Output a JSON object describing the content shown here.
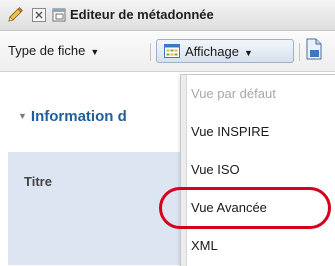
{
  "window": {
    "title": "Editeur de métadonnée"
  },
  "toolbar": {
    "type_label": "Type de fiche",
    "affichage_label": "Affichage",
    "caret": "▼"
  },
  "content": {
    "section_title": "Information d",
    "section_toggle": "▼",
    "field_label": "Titre"
  },
  "menu": {
    "items": [
      {
        "label": "Vue par défaut",
        "disabled": true
      },
      {
        "label": "Vue INSPIRE",
        "disabled": false
      },
      {
        "label": "Vue ISO",
        "disabled": false
      },
      {
        "label": "Vue Avancée",
        "disabled": false,
        "highlighted": true
      },
      {
        "label": "XML",
        "disabled": false
      }
    ]
  },
  "colors": {
    "accent_blue": "#1f5f9e",
    "highlight_red": "#d6001c",
    "panel_blue": "#dde5f2"
  },
  "icons": {
    "edit": "pencil-icon",
    "close": "close-box-icon",
    "window": "window-icon",
    "grid": "grid-view-icon",
    "document": "document-icon"
  }
}
